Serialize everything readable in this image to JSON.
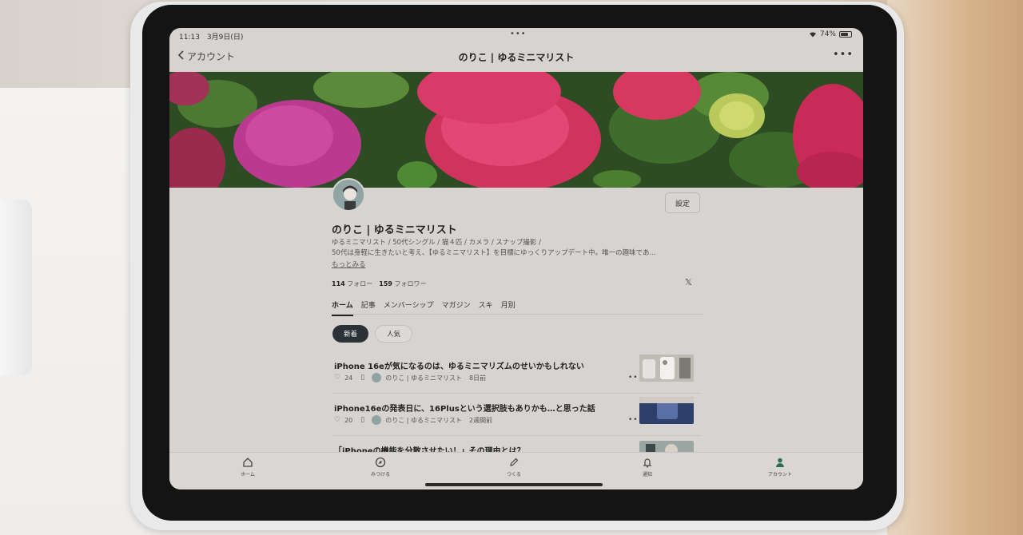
{
  "status_bar": {
    "time_date": "11:13　3月9日(日)",
    "dots": "•••",
    "battery": "74%",
    "battery_level": 0.74
  },
  "nav": {
    "back_label": "アカウント",
    "title": "のりこ | ゆるミニマリスト",
    "more": "•••"
  },
  "profile": {
    "settings_label": "設定",
    "name": "のりこ | ゆるミニマリスト",
    "bio_line1": "ゆるミニマリスト / 50代シングル / 猫４匹 / カメラ / スナップ撮影 /",
    "bio_line2": "50代は身軽に生きたいと考え、【ゆるミニマリスト】を目標にゆっくりアップデート中。唯一の趣味であ…",
    "more_link": "もっとみる",
    "follow_count": "114",
    "follow_label": "フォロー",
    "follower_count": "159",
    "follower_label": "フォロワー",
    "x_icon": "𝕏"
  },
  "tabs": [
    {
      "label": "ホーム"
    },
    {
      "label": "記事"
    },
    {
      "label": "メンバーシップ"
    },
    {
      "label": "マガジン"
    },
    {
      "label": "スキ"
    },
    {
      "label": "月別"
    }
  ],
  "chips": {
    "new": "新着",
    "popular": "人気"
  },
  "articles": [
    {
      "title": "iPhone 16eが気になるのは、ゆるミニマリズムのせいかもしれない",
      "likes": "24",
      "author": "のりこ | ゆるミニマリスト",
      "date": "8日前"
    },
    {
      "title": "iPhone16eの発表日に、16Plusという選択肢もありかも…と思った話",
      "likes": "20",
      "author": "のりこ | ゆるミニマリスト",
      "date": "2週間前"
    },
    {
      "title": "「iPhoneの機能を分散させたい！」その理由とは？"
    }
  ],
  "tabbar": [
    {
      "label": "ホーム",
      "icon": "home-icon"
    },
    {
      "label": "みつける",
      "icon": "compass-icon"
    },
    {
      "label": "つくる",
      "icon": "pencil-icon"
    },
    {
      "label": "通知",
      "icon": "bell-icon"
    },
    {
      "label": "アカウント",
      "icon": "person-icon"
    }
  ],
  "colors": {
    "accent_dark": "#2a3236",
    "account_green": "#2f6b57",
    "screen_bg": "#d6d3d0"
  }
}
